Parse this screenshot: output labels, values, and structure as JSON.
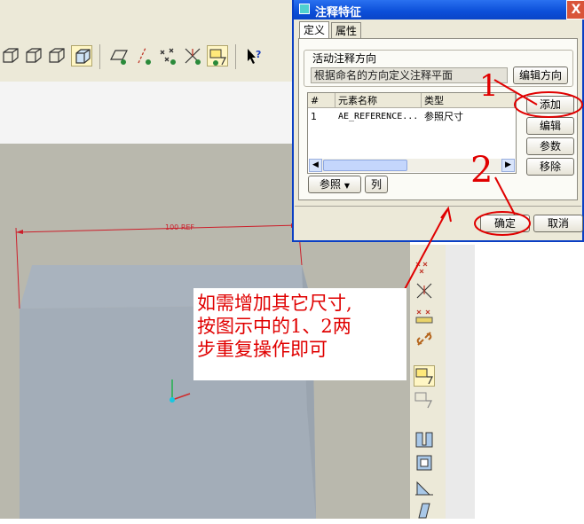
{
  "dialog": {
    "title": "注释特征",
    "close_glyph": "X",
    "tabs": [
      {
        "label": "定义"
      },
      {
        "label": "属性"
      }
    ],
    "direction_group": {
      "label": "活动注释方向",
      "value": "根据命名的方向定义注释平面",
      "edit_button": "编辑方向"
    },
    "table": {
      "columns": [
        "#",
        "元素名称",
        "类型"
      ],
      "rows": [
        {
          "num": "1",
          "name": "AE_REFERENCE...",
          "type": "参照尺寸"
        }
      ]
    },
    "side_buttons": {
      "add": "添加",
      "edit": "编辑",
      "params": "参数",
      "remove": "移除"
    },
    "ref_button": "参照",
    "col_button": "列",
    "ok_button": "确定",
    "cancel_button": "取消"
  },
  "model": {
    "dimension_label": "100 REF"
  },
  "annotations": {
    "step1": "1",
    "step2": "2",
    "note_lines": [
      "如需增加其它尺寸,",
      "按图示中的1、2两",
      "步重复操作即可"
    ],
    "color": "#e00000"
  },
  "colors": {
    "title_bar": "#0b4ed8",
    "dialog_bg": "#ece9d8",
    "viewport_bg": "#b9b8ad",
    "model_face": "#a6b0bb"
  }
}
